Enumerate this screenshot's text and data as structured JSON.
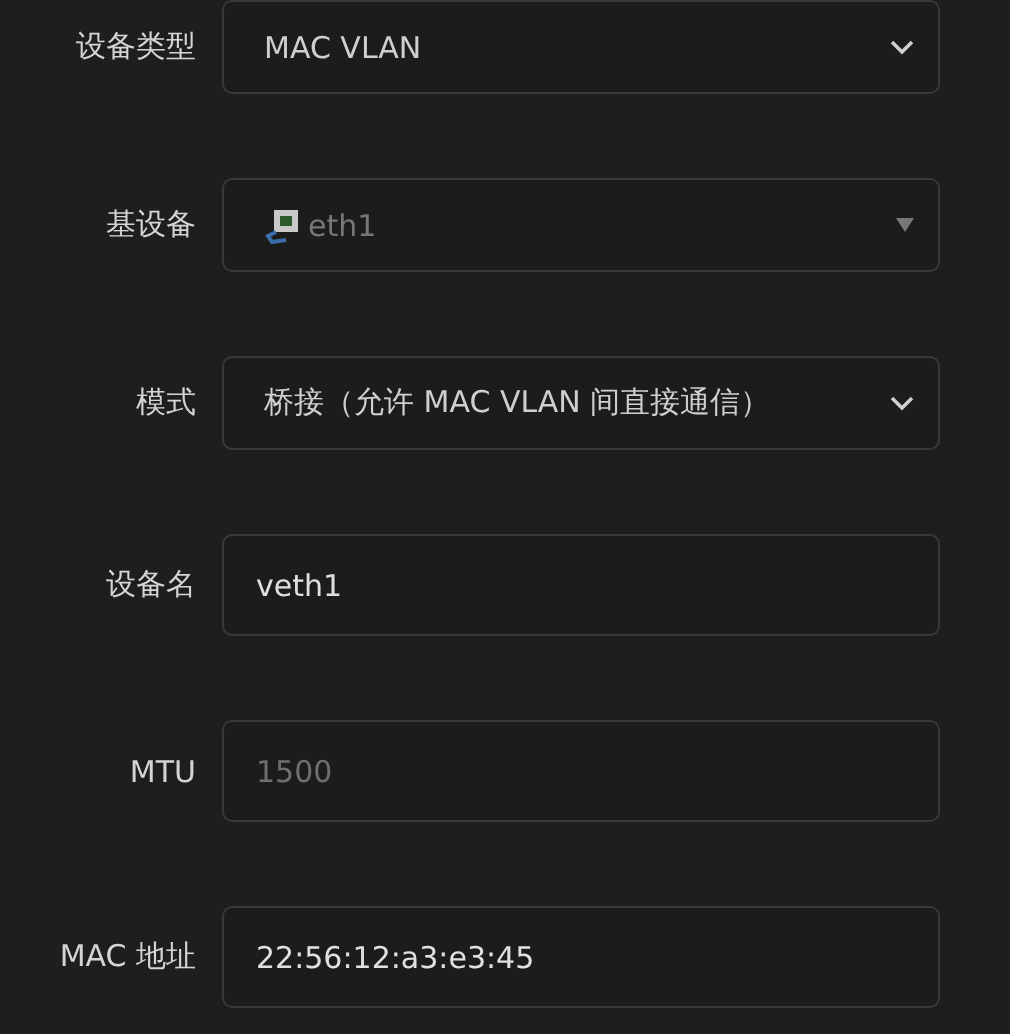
{
  "fields": [
    {
      "label": "设备类型",
      "kind": "select",
      "value": "MAC VLAN",
      "disabled": false
    },
    {
      "label": "基设备",
      "kind": "select",
      "value": "eth1",
      "disabled": true
    },
    {
      "label": "模式",
      "kind": "select",
      "value": "桥接（允许 MAC VLAN 间直接通信）",
      "disabled": false
    },
    {
      "label": "设备名",
      "kind": "input",
      "value": "veth1"
    },
    {
      "label": "MTU",
      "kind": "input",
      "placeholder": "1500"
    },
    {
      "label": "MAC 地址",
      "kind": "input",
      "value": "22:56:12:a3:e3:45"
    }
  ]
}
